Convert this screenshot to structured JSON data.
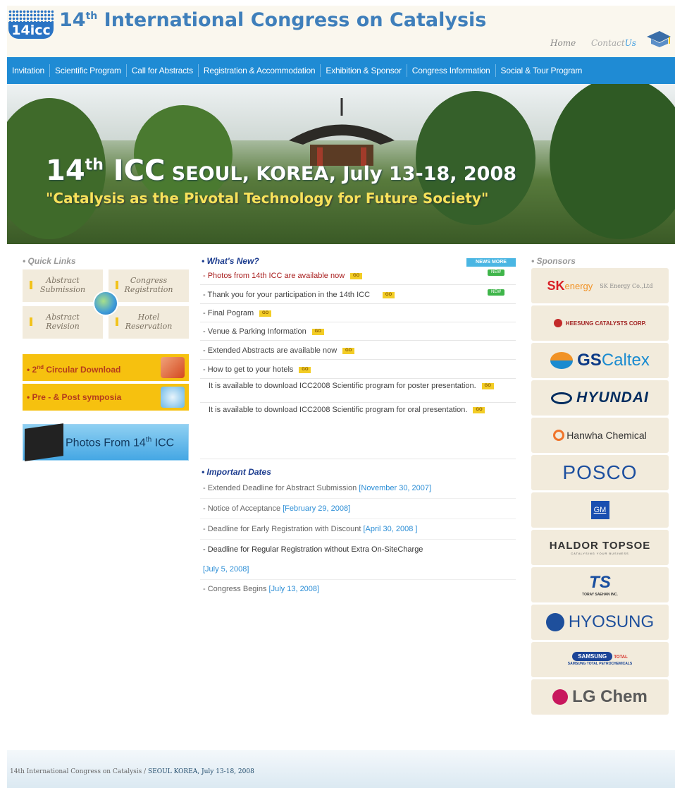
{
  "header": {
    "logo_text": "14icc",
    "title_pre": "14",
    "title_sup": "th",
    "title_post": " International Congress on Catalysis",
    "home_label": "Home",
    "contact_label_a": "Contact",
    "contact_label_b": "Us"
  },
  "nav": [
    {
      "label": "Invitation"
    },
    {
      "label": "Scientific Program"
    },
    {
      "label": "Call for Abstracts"
    },
    {
      "label": "Registration & Accommodation"
    },
    {
      "label": "Exhibition & Sponsor"
    },
    {
      "label": "Congress Information"
    },
    {
      "label": "Social & Tour Program"
    }
  ],
  "banner": {
    "title_num": "14",
    "title_sup": "th",
    "title_icc": " ICC",
    "title_rest": " SEOUL, KOREA, July 13-18, 2008",
    "subtitle": "\"Catalysis as the Pivotal Technology for Future Society\""
  },
  "quick_links": {
    "heading": "• Quick Links",
    "items": [
      {
        "line1": "Abstract",
        "line2": "Submission"
      },
      {
        "line1": "Congress",
        "line2": "Registration"
      },
      {
        "line1": "Abstract",
        "line2": "Revision"
      },
      {
        "line1": "Hotel",
        "line2": "Reservation"
      }
    ]
  },
  "buttons": {
    "circular_pre": "• 2",
    "circular_sup": "nd",
    "circular_post": " Circular Download",
    "symposia": "• Pre - & Post symposia",
    "photos_pre": "Photos From 14",
    "photos_sup": "th",
    "photos_post": " ICC"
  },
  "whats_new": {
    "heading": "• What's New?",
    "more_label": "NEWS MORE",
    "go_label": "GO",
    "new_label": "NEW",
    "items": [
      {
        "text": "- Photos from 14th ICC are available now"
      },
      {
        "text": "- Thank you for your participation in the 14th ICC"
      },
      {
        "text": "- Final Pogram"
      },
      {
        "text": "- Venue & Parking Information"
      },
      {
        "text": "- Extended Abstracts are available now"
      },
      {
        "text": "- How to get to your hotels"
      },
      {
        "text": "It is available to download ICC2008 Scientific program for poster presentation."
      },
      {
        "text": "It is available to download ICC2008 Scientific program for oral presentation."
      }
    ]
  },
  "important_dates": {
    "heading": "• Important Dates",
    "items": [
      {
        "label": "- Extended Deadline for Abstract Submission ",
        "date": "[November 30, 2007]"
      },
      {
        "label": "- Notice of Acceptance ",
        "date": "[February 29, 2008]"
      },
      {
        "label": "- Deadline for Early Registration with Discount ",
        "date": "[April 30, 2008 ]"
      },
      {
        "label": "- Deadline for Regular Registration without Extra On-SiteCharge",
        "date": ""
      },
      {
        "label": "",
        "date": "[July 5, 2008]"
      },
      {
        "label": "- Congress Begins ",
        "date": "[July 13, 2008]"
      }
    ]
  },
  "sponsors": {
    "heading": "• Sponsors",
    "sk": {
      "a": "SK",
      "b": "energy",
      "c": "SK Energy Co.,Ltd"
    },
    "heesung": "HEESUNG CATALYSTS CORP.",
    "gs": {
      "a": "GS",
      "b": " Caltex"
    },
    "hyundai": "HYUNDAI",
    "hanwha": "Hanwha Chemical",
    "posco": "POSCO",
    "gm": "GM",
    "haldor": {
      "a": "HALDOR TOPSOE",
      "b": "CATALYSING YOUR BUSINESS"
    },
    "toray": {
      "a": "TS",
      "b": "TORAY SAEHAN INC."
    },
    "hyosung": "HYOSUNG",
    "samsung": {
      "a": "SAMSUNG",
      "b": "TOTAL",
      "c": "SAMSUNG TOTAL PETROCHEMICALS"
    },
    "lg": "LG Chem"
  },
  "footer": {
    "a": "14th International Congress on Catalysis / ",
    "b": "SEOUL KOREA, July 13-18,  2008"
  },
  "colors": {
    "nav_blue": "#1f8bd4",
    "title_blue": "#3f7fbb",
    "accent_yellow": "#f6c10f",
    "news_red": "#a81d1d"
  }
}
